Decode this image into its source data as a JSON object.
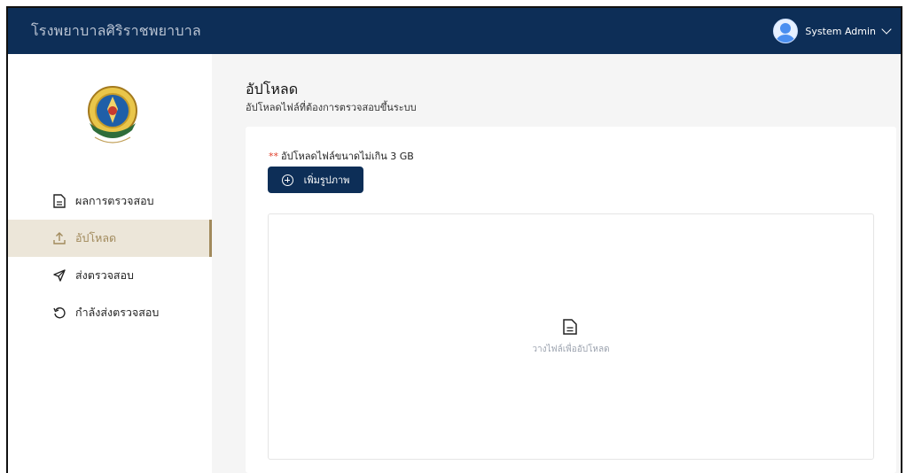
{
  "header": {
    "hospital_name": "โรงพยาบาลศิริราชพยาบาล",
    "user_name": "System Admin"
  },
  "sidebar": {
    "items": [
      {
        "label": "ผลการตรวจสอบ",
        "icon": "document-icon",
        "active": false
      },
      {
        "label": "อัปโหลด",
        "icon": "upload-icon",
        "active": true
      },
      {
        "label": "ส่งตรวจสอบ",
        "icon": "send-icon",
        "active": false
      },
      {
        "label": "กำลังส่งตรวจสอบ",
        "icon": "refresh-icon",
        "active": false
      }
    ]
  },
  "main": {
    "title": "อัปโหลด",
    "subtitle": "อัปโหลดไฟล์ที่ต้องการตรวจสอบขึ้นระบบ",
    "note_marker": "**",
    "note": "อัปโหลดไฟล์ขนาดไม่เกิน 3 GB",
    "add_button": "เพิ่มรูปภาพ",
    "dropzone_text": "วางไฟล์เพื่ออัปโหลด"
  },
  "colors": {
    "header_bg": "#0d2e57",
    "active_bg": "#ece6d9",
    "active_accent": "#a18a5c",
    "required_marker": "#e0402b"
  }
}
